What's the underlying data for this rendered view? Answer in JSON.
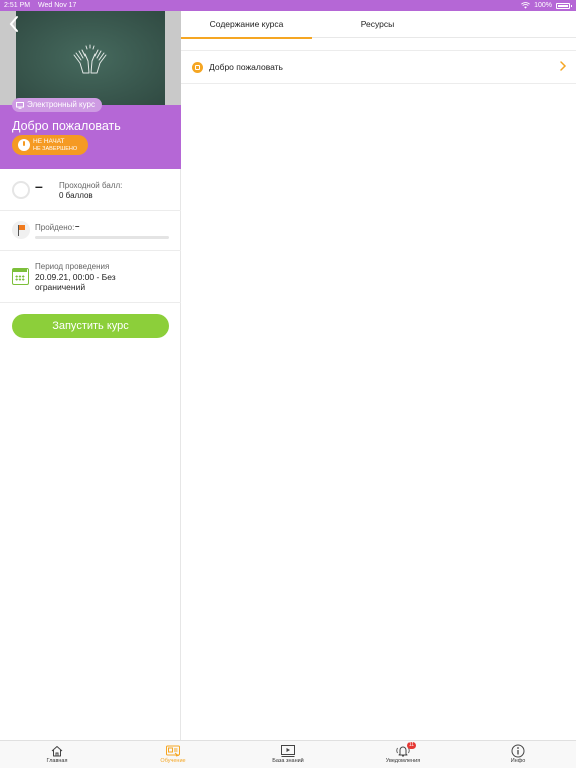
{
  "status_bar": {
    "time": "2:51 PM",
    "date": "Wed Nov 17",
    "battery": "100%"
  },
  "course": {
    "type": "Электронный курс",
    "title": "Добро пожаловать",
    "status_line1": "НЕ НАЧАТ",
    "status_line2": "НЕ ЗАВЕРШЕНО",
    "score_value": "–",
    "score_label": "Проходной балл:",
    "score_points": "0 баллов",
    "passed_label": "Пройдено:",
    "passed_value": "–",
    "passed_progress": 0,
    "period_label": "Период проведения",
    "period_value": "20.09.21, 00:00 - Без ограничений",
    "start_label": "Запустить курс"
  },
  "tabs": [
    {
      "label": "Содержание курса",
      "active": true
    },
    {
      "label": "Ресурсы",
      "active": false
    }
  ],
  "content_items": [
    {
      "label": "Добро пожаловать"
    }
  ],
  "bottom_nav": [
    {
      "label": "Главная",
      "icon": "house-icon"
    },
    {
      "label": "Обучение",
      "icon": "learning-icon",
      "active": true
    },
    {
      "label": "База знаний",
      "icon": "knowledge-base-icon"
    },
    {
      "label": "Уведомления",
      "icon": "bell-icon",
      "badge": "11"
    },
    {
      "label": "Инфо",
      "icon": "info-icon"
    }
  ],
  "colors": {
    "accent_purple": "#b567d6",
    "accent_orange": "#f5a623",
    "accent_green": "#8ccf3a"
  }
}
